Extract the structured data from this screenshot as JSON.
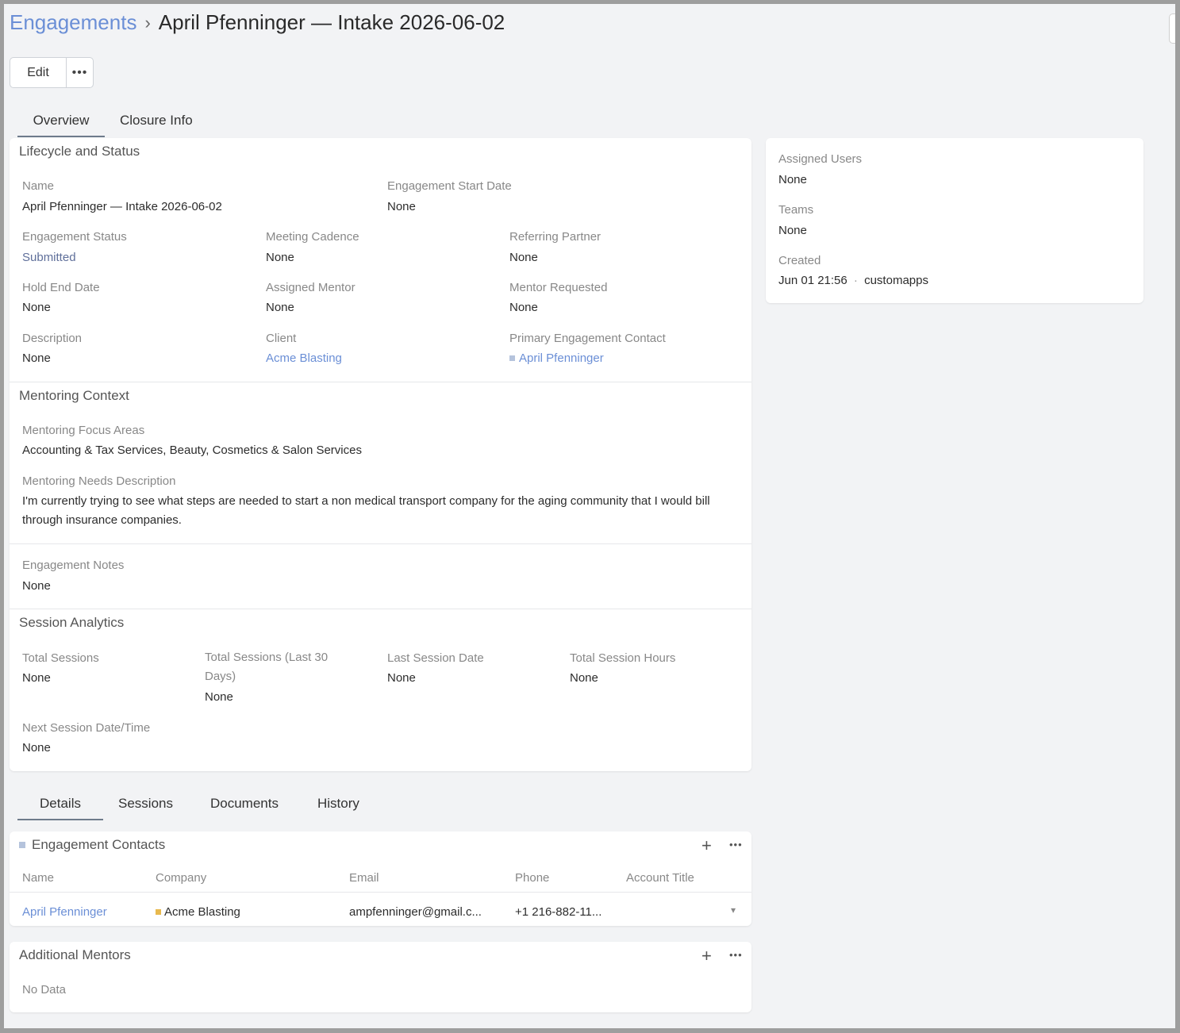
{
  "breadcrumb": {
    "parent": "Engagements",
    "separator": "›",
    "current": "April Pfenninger — Intake 2026-06-02"
  },
  "toolbar": {
    "edit_label": "Edit",
    "more_label": "•••"
  },
  "top_tabs": [
    "Overview",
    "Closure Info"
  ],
  "lifecycle": {
    "title": "Lifecycle and Status",
    "name_label": "Name",
    "name_value": "April Pfenninger — Intake 2026-06-02",
    "start_date_label": "Engagement Start Date",
    "start_date_value": "None",
    "status_label": "Engagement Status",
    "status_value": "Submitted",
    "cadence_label": "Meeting Cadence",
    "cadence_value": "None",
    "referring_label": "Referring Partner",
    "referring_value": "None",
    "hold_label": "Hold End Date",
    "hold_value": "None",
    "mentor_label": "Assigned Mentor",
    "mentor_value": "None",
    "mentor_req_label": "Mentor Requested",
    "mentor_req_value": "None",
    "description_label": "Description",
    "description_value": "None",
    "client_label": "Client",
    "client_value": "Acme Blasting",
    "contact_label": "Primary Engagement Contact",
    "contact_value": "April Pfenninger"
  },
  "mentoring": {
    "title": "Mentoring Context",
    "focus_label": "Mentoring Focus Areas",
    "focus_value": "Accounting & Tax Services, Beauty, Cosmetics & Salon Services",
    "needs_label": "Mentoring Needs Description",
    "needs_value": "I'm currently trying to see what steps are needed to start a non medical transport company for the aging community that I would bill through insurance companies."
  },
  "notes": {
    "label": "Engagement Notes",
    "value": "None"
  },
  "analytics": {
    "title": "Session Analytics",
    "total_label": "Total Sessions",
    "total_value": "None",
    "last30_label": "Total Sessions (Last 30 Days)",
    "last30_value": "None",
    "last_date_label": "Last Session Date",
    "last_date_value": "None",
    "hours_label": "Total Session Hours",
    "hours_value": "None",
    "next_label": "Next Session Date/Time",
    "next_value": "None"
  },
  "sidebar": {
    "users_label": "Assigned Users",
    "users_value": "None",
    "teams_label": "Teams",
    "teams_value": "None",
    "created_label": "Created",
    "created_date": "Jun 01 21:56",
    "created_dot": "·",
    "created_by": "customapps"
  },
  "bottom_tabs": [
    "Details",
    "Sessions",
    "Documents",
    "History"
  ],
  "contacts": {
    "title": "Engagement Contacts",
    "add_icon": "+",
    "more_icon": "•••",
    "columns": [
      "Name",
      "Company",
      "Email",
      "Phone",
      "Account Title"
    ],
    "row": {
      "name": "April Pfenninger",
      "company": "Acme Blasting",
      "email": "ampfenninger@gmail.c...",
      "phone": "+1 216-882-11...",
      "account_title": ""
    },
    "caret": "▾"
  },
  "mentors": {
    "title": "Additional Mentors",
    "add_icon": "+",
    "more_icon": "•••",
    "empty": "No Data"
  },
  "colors": {
    "link": "#6b8fd6",
    "status": "#5f6f9a",
    "contact_square": "#b5c3dc",
    "company_square": "#e8b94e"
  }
}
